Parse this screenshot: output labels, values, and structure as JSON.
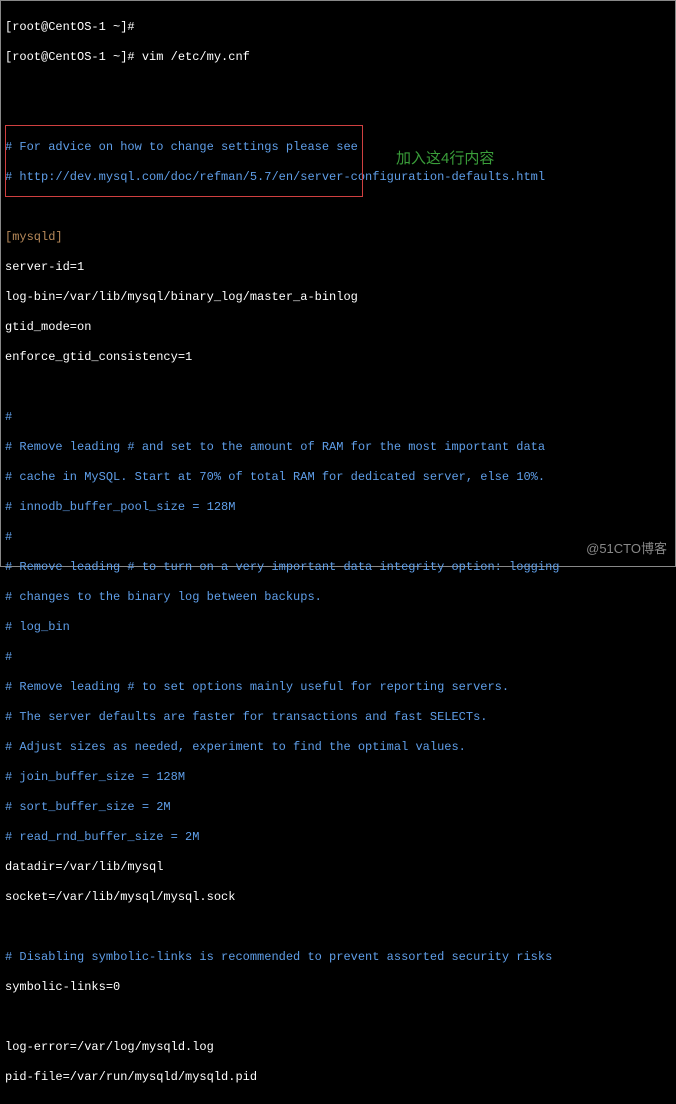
{
  "prompt_line1": "[root@CentOS-1 ~]#",
  "prompt_line2": "[root@CentOS-1 ~]# vim /etc/my.cnf",
  "comment_advice1": "# For advice on how to change settings please see",
  "comment_advice2": "# http://dev.mysql.com/doc/refman/5.7/en/server-configuration-defaults.html",
  "section_mysqld": "[mysqld]",
  "config": {
    "server_id": "server-id=1",
    "log_bin": "log-bin=/var/lib/mysql/binary_log/master_a-binlog",
    "gtid_mode": "gtid_mode=on",
    "enforce_gtid": "enforce_gtid_consistency=1"
  },
  "annotation_text": "加入这4行内容",
  "comments": {
    "c1": "#",
    "c2": "# Remove leading # and set to the amount of RAM for the most important data",
    "c3": "# cache in MySQL. Start at 70% of total RAM for dedicated server, else 10%.",
    "c4": "# innodb_buffer_pool_size = 128M",
    "c5": "#",
    "c6": "# Remove leading # to turn on a very important data integrity option: logging",
    "c7": "# changes to the binary log between backups.",
    "c8": "# log_bin",
    "c9": "#",
    "c10": "# Remove leading # to set options mainly useful for reporting servers.",
    "c11": "# The server defaults are faster for transactions and fast SELECTs.",
    "c12": "# Adjust sizes as needed, experiment to find the optimal values.",
    "c13": "# join_buffer_size = 128M",
    "c14": "# sort_buffer_size = 2M",
    "c15": "# read_rnd_buffer_size = 2M"
  },
  "config2": {
    "datadir": "datadir=/var/lib/mysql",
    "socket": "socket=/var/lib/mysql/mysql.sock"
  },
  "comment_symlinks": "# Disabling symbolic-links is recommended to prevent assorted security risks",
  "config3": {
    "symbolic_links": "symbolic-links=0",
    "log_error": "log-error=/var/log/mysqld.log",
    "pid_file": "pid-file=/var/run/mysqld/mysqld.pid"
  },
  "watermark": "@51CTO博客"
}
